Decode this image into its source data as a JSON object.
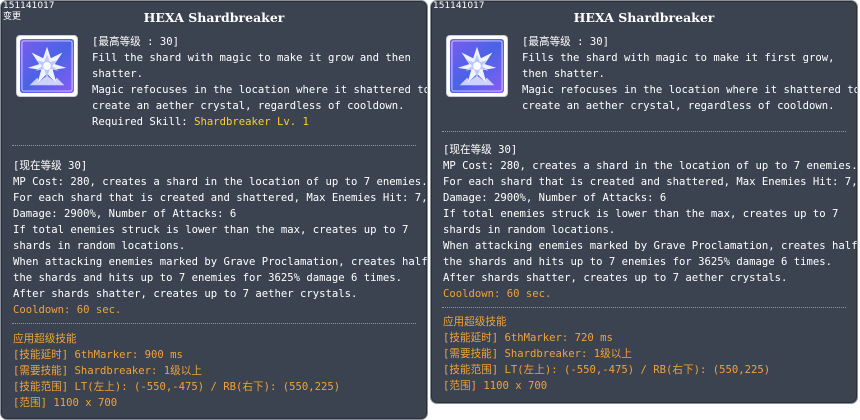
{
  "left": {
    "id_text": "151141017",
    "tag_text": "变更",
    "title": "HEXA Shardbreaker",
    "icon": "hexa-shardbreaker-skill-icon",
    "desc_lines": [
      "[最高等级 : 30]",
      "Fill the shard with magic to make it grow and then",
      " shatter.",
      "Magic refocuses in the location where it shattered to",
      "create an aether crystal, regardless of cooldown."
    ],
    "required_prefix": "Required Skill: ",
    "required_skill": "Shardbreaker Lv. 1",
    "level_lines": [
      "[现在等级 30]",
      "MP Cost: 280, creates a shard in the location of up to 7 enemies.",
      "For each shard that is created and shattered, Max Enemies Hit: 7,",
      "Damage: 2900%, Number of Attacks: 6",
      "If total enemies struck is lower than the max, creates up to 7",
      "shards in random locations.",
      "When attacking enemies marked by Grave Proclamation, creates half",
      "the shards and hits up to 7 enemies for 3625% damage 6 times.",
      "After shards shatter, creates up to 7 aether crystals."
    ],
    "cooldown": "Cooldown: 60 sec.",
    "hyper_lines": [
      "应用超级技能",
      "[技能延时] 6thMarker: 900 ms",
      "[需要技能] Shardbreaker: 1级以上",
      "[技能范围] LT(左上): (-550,-475) / RB(右下): (550,225)",
      "[范围] 1100 x 700"
    ]
  },
  "right": {
    "id_text": "151141017",
    "title": "HEXA Shardbreaker",
    "icon": "hexa-shardbreaker-skill-icon",
    "desc_lines": [
      "[最高等级 : 30]",
      "Fills the shard with magic to make it first grow,",
      " then shatter.",
      "Magic refocuses in the location where it shattered to",
      "create an aether crystal, regardless of cooldown."
    ],
    "level_lines": [
      "[现在等级 30]",
      "MP Cost: 280, creates a shard in the location of up to 7 enemies.",
      "For each shard that is created and shattered, Max Enemies Hit: 7,",
      "Damage: 2900%, Number of Attacks: 6",
      "If total enemies struck is lower than the max, creates up to 7",
      "shards in random locations.",
      "When attacking enemies marked by Grave Proclamation, creates half",
      "the shards and hits up to 7 enemies for 3625% damage 6 times.",
      "After shards shatter, creates up to 7 aether crystals."
    ],
    "cooldown": "Cooldown: 60 sec.",
    "hyper_lines": [
      "应用超级技能",
      "[技能延时] 6thMarker: 720 ms",
      "[需要技能] Shardbreaker: 1级以上",
      "[技能范围] LT(左上): (-550,-475) / RB(右下): (550,225)",
      "[范围] 1100 x 700"
    ]
  },
  "colors": {
    "panel_bg": "#3b4250",
    "text": "#ffffff",
    "required_skill": "#ffcc33",
    "cooldown_and_hyper": "#f0a33a"
  }
}
